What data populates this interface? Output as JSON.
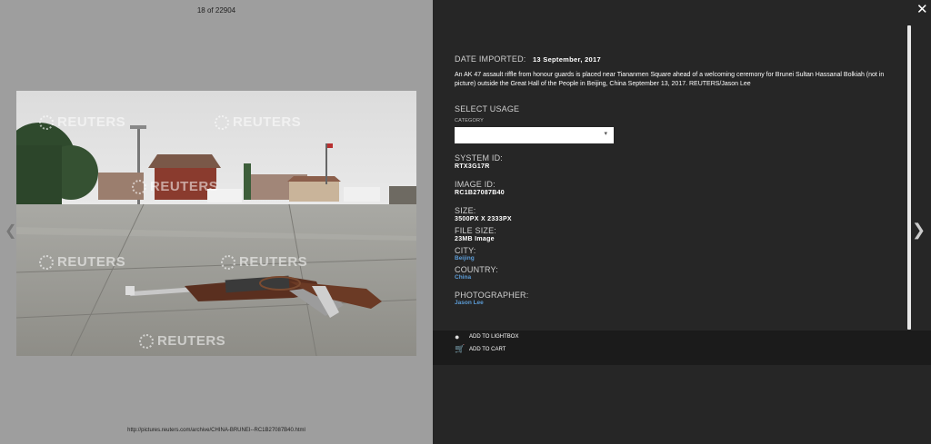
{
  "viewer": {
    "counter": "18 of 22904",
    "url": "http://pictures.reuters.com/archive/CHINA-BRUNEI--RC1B27087B40.html",
    "watermark": "REUTERS",
    "prev_icon": "chevron-left-icon",
    "next_icon": "chevron-right-icon",
    "close_icon": "close-icon"
  },
  "details": {
    "date_label": "DATE IMPORTED:",
    "date_value": "13 September, 2017",
    "description": "An AK 47 assault riffle from honour guards is placed near Tiananmen Square ahead of a welcoming ceremony for Brunei Sultan Hassanal Bolkiah (not in picture) outside the Great Hall of the People in Beijing, China September 13, 2017. REUTERS/Jason Lee",
    "select_usage_label": "SELECT USAGE",
    "category_label": "CATEGORY",
    "category_value": "",
    "system_id_label": "SYSTEM ID:",
    "system_id_value": "RTX3G17R",
    "image_id_label": "IMAGE ID:",
    "image_id_value": "RC1B27087B40",
    "size_label": "SIZE:",
    "size_value": "3500PX X 2333PX",
    "file_size_label": "FILE SIZE:",
    "file_size_value": "23MB Image",
    "city_label": "CITY:",
    "city_value": "Beijing",
    "country_label": "COUNTRY:",
    "country_value": "China",
    "photographer_label": "PHOTOGRAPHER:",
    "photographer_value": "Jason Lee"
  },
  "actions": {
    "lightbox": "ADD TO LIGHTBOX",
    "cart": "ADD TO CART"
  },
  "colors": {
    "panel": "#262626",
    "viewer_bg": "#9e9e9e",
    "link": "#5b9bd5"
  }
}
